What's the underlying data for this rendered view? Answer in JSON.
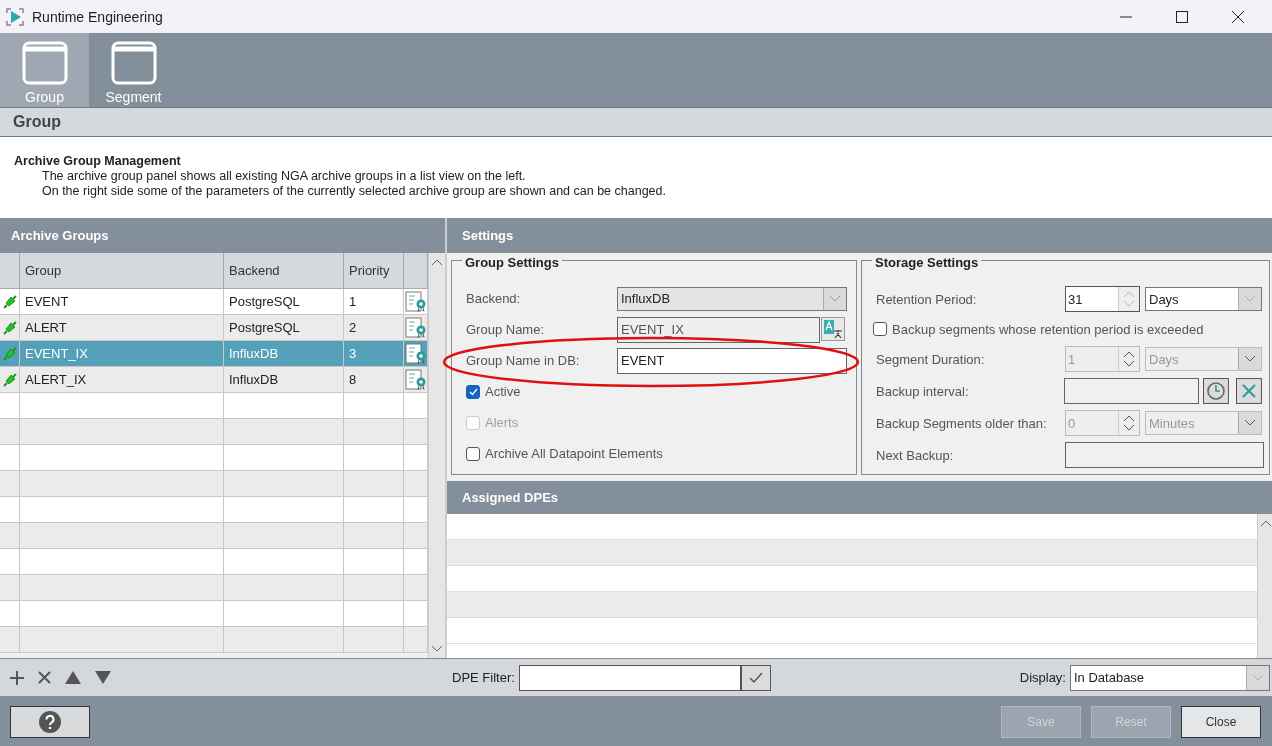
{
  "window": {
    "title": "Runtime Engineering"
  },
  "toolbar": [
    {
      "label": "Group",
      "selected": true
    },
    {
      "label": "Segment",
      "selected": false
    }
  ],
  "section_title": "Group",
  "description": {
    "title": "Archive Group Management",
    "lines": [
      "The archive group panel shows all existing NGA archive groups in a list view on the left.",
      "On the right side some of the parameters of the currently selected archive group are shown and can be changed."
    ]
  },
  "archive_groups": {
    "title": "Archive Groups",
    "columns": [
      "Group",
      "Backend",
      "Priority"
    ],
    "rows": [
      {
        "group": "EVENT",
        "backend": "PostgreSQL",
        "priority": "1",
        "selected": false
      },
      {
        "group": "ALERT",
        "backend": "PostgreSQL",
        "priority": "2",
        "selected": false
      },
      {
        "group": "EVENT_IX",
        "backend": "InfluxDB",
        "priority": "3",
        "selected": true
      },
      {
        "group": "ALERT_IX",
        "backend": "InfluxDB",
        "priority": "8",
        "selected": false
      }
    ]
  },
  "settings": {
    "title": "Settings",
    "group_settings": {
      "title": "Group Settings",
      "fields": [
        {
          "kind": "select",
          "label": "Backend:",
          "value": "InfluxDB"
        },
        {
          "kind": "translate",
          "label": "Group Name:",
          "value": "EVENT_IX"
        },
        {
          "kind": "text",
          "label": "Group Name in DB:",
          "value": "EVENT"
        }
      ],
      "checks": [
        {
          "label": "Active",
          "checked": true,
          "disabled": false
        },
        {
          "label": "Alerts",
          "checked": false,
          "disabled": true
        },
        {
          "label": "Archive All Datapoint Elements",
          "checked": false,
          "disabled": false
        }
      ]
    },
    "storage_settings": {
      "title": "Storage Settings",
      "rows": [
        {
          "kind": "spin",
          "label": "Retention Period:",
          "value": "31",
          "unit": "Days",
          "disabled": false
        },
        {
          "kind": "check",
          "label": "Backup segments whose retention period is exceeded",
          "checked": false
        },
        {
          "kind": "spin",
          "label": "Segment Duration:",
          "value": "1",
          "unit": "Days",
          "disabled": true
        },
        {
          "kind": "time",
          "label": "Backup interval:"
        },
        {
          "kind": "spin",
          "label": "Backup Segments older than:",
          "value": "0",
          "unit": "Minutes",
          "disabled": true
        },
        {
          "kind": "text",
          "label": "Next Backup:"
        }
      ]
    }
  },
  "assigned_dpes": {
    "title": "Assigned DPEs"
  },
  "filter": {
    "label": "DPE Filter:"
  },
  "display": {
    "label": "Display:",
    "value": "In Database"
  },
  "buttons": [
    {
      "label": "Save",
      "disabled": true
    },
    {
      "label": "Reset",
      "disabled": true
    },
    {
      "label": "Close",
      "disabled": false
    }
  ]
}
